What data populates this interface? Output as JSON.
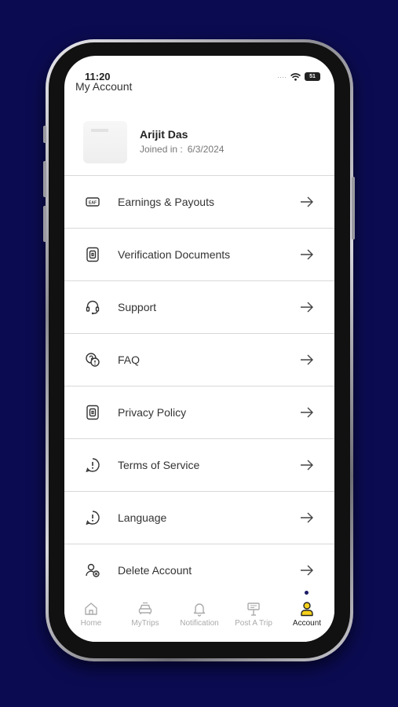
{
  "status_bar": {
    "time": "11:20",
    "battery": "51"
  },
  "header": {
    "title": "My Account"
  },
  "profile": {
    "name": "Arijit Das",
    "joined_label": "Joined in :",
    "joined_date": "6/3/2024"
  },
  "menu": [
    {
      "label": "Earnings & Payouts",
      "icon": "earnings-icon"
    },
    {
      "label": "Verification Documents",
      "icon": "document-icon"
    },
    {
      "label": "Support",
      "icon": "headset-icon"
    },
    {
      "label": "FAQ",
      "icon": "faq-icon"
    },
    {
      "label": "Privacy Policy",
      "icon": "document-icon"
    },
    {
      "label": "Terms of Service",
      "icon": "alert-icon"
    },
    {
      "label": "Language",
      "icon": "alert-icon"
    },
    {
      "label": "Delete Account",
      "icon": "user-delete-icon"
    }
  ],
  "bottom_nav": [
    {
      "label": "Home",
      "icon": "home-icon",
      "active": false
    },
    {
      "label": "MyTrips",
      "icon": "car-icon",
      "active": false
    },
    {
      "label": "Notification",
      "icon": "bell-icon",
      "active": false
    },
    {
      "label": "Post A Trip",
      "icon": "signpost-icon",
      "active": false
    },
    {
      "label": "Account",
      "icon": "user-icon",
      "active": true
    }
  ],
  "colors": {
    "background": "#0b0b52",
    "accent": "#f7d21a",
    "text": "#333333"
  }
}
